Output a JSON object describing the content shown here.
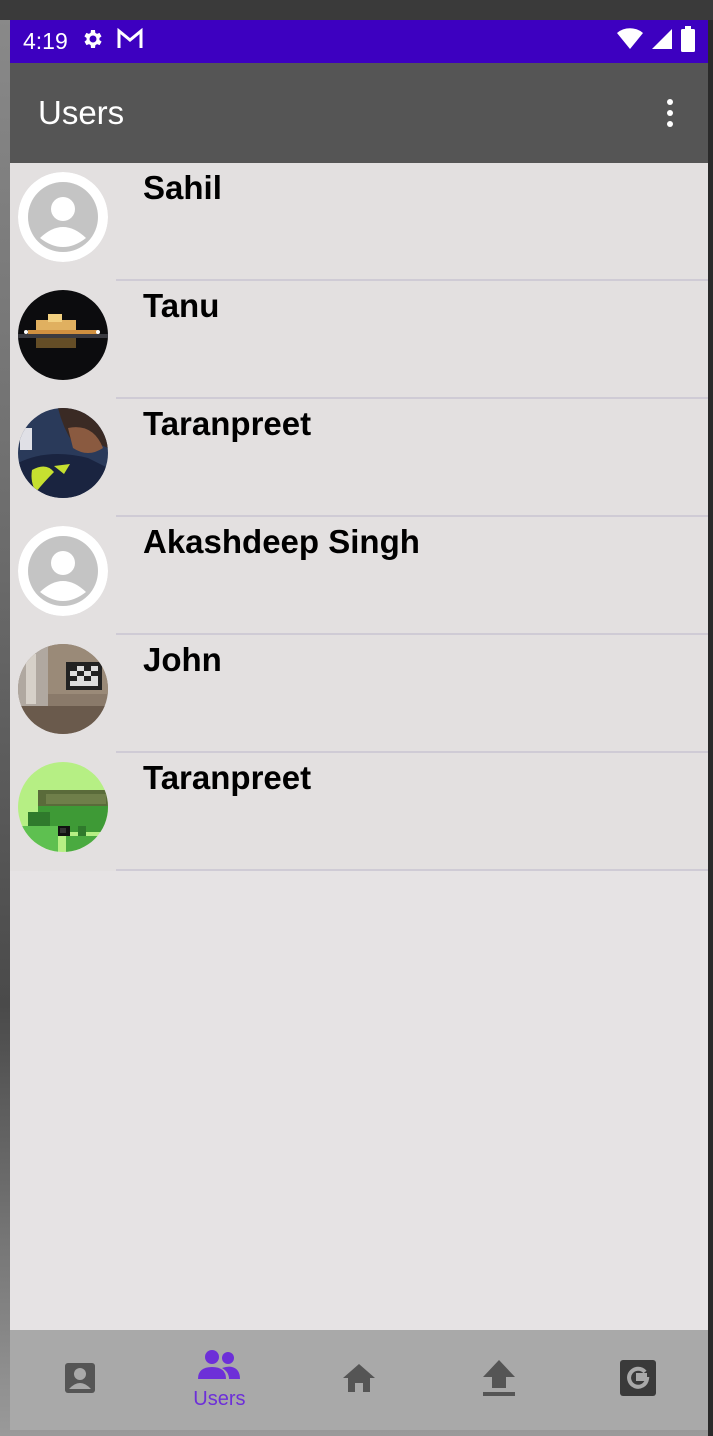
{
  "status_bar": {
    "time": "4:19",
    "icons": [
      "gear-icon",
      "gmail-icon",
      "wifi-icon",
      "signal-icon",
      "battery-icon"
    ]
  },
  "app_bar": {
    "title": "Users",
    "menu_icon": "more-vert-icon"
  },
  "users": [
    {
      "name": "Sahil",
      "avatar": "default-avatar"
    },
    {
      "name": "Tanu",
      "avatar": "photo-night-temple"
    },
    {
      "name": "Taranpreet",
      "avatar": "photo-person"
    },
    {
      "name": "Akashdeep Singh",
      "avatar": "default-avatar"
    },
    {
      "name": "John",
      "avatar": "photo-room"
    },
    {
      "name": "Taranpreet",
      "avatar": "photo-green-pixel"
    }
  ],
  "bottom_nav": {
    "items": [
      {
        "icon": "contact-icon",
        "label": ""
      },
      {
        "icon": "group-icon",
        "label": "Users",
        "selected": true
      },
      {
        "icon": "home-icon",
        "label": ""
      },
      {
        "icon": "upload-icon",
        "label": ""
      },
      {
        "icon": "google-icon",
        "label": ""
      }
    ]
  },
  "colors": {
    "status_bar": "#3d00c0",
    "app_bar": "#555555",
    "accent": "#6d2fd8",
    "nav_bg": "#a9a9a9",
    "list_bg": "#e3e0e0"
  }
}
